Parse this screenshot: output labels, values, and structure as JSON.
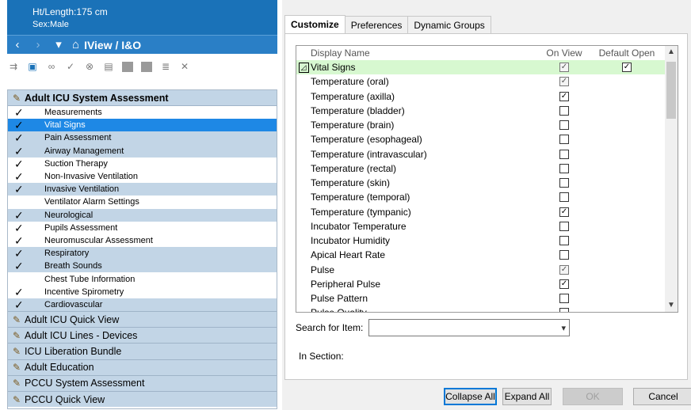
{
  "patient": {
    "height": "Ht/Length:175 cm",
    "sex": "Sex:Male"
  },
  "nav": {
    "back": "‹",
    "forward": "›",
    "dropdown": "▾",
    "home": "⌂",
    "title": "IView / I&O"
  },
  "toolbar_icons": [
    "link-icon",
    "view-icon",
    "glasses-icon",
    "check-icon",
    "cancel-circle-icon",
    "clipboard-icon",
    "grey-block-icon",
    "grey-block-icon",
    "notes-icon",
    "close-icon"
  ],
  "sidebar": {
    "top_section": "Adult ICU System Assessment",
    "rows": [
      {
        "label": "Measurements",
        "checked": true,
        "style": "plain"
      },
      {
        "label": "Vital Signs",
        "checked": true,
        "style": "sel"
      },
      {
        "label": "Pain Assessment",
        "checked": true,
        "style": "alt"
      },
      {
        "label": "Airway Management",
        "checked": true,
        "style": "alt"
      },
      {
        "label": "Suction Therapy",
        "checked": true,
        "style": "plain"
      },
      {
        "label": "Non-Invasive Ventilation",
        "checked": true,
        "style": "plain"
      },
      {
        "label": "Invasive Ventilation",
        "checked": true,
        "style": "alt"
      },
      {
        "label": "Ventilator Alarm Settings",
        "checked": false,
        "style": "plain"
      },
      {
        "label": "Neurological",
        "checked": true,
        "style": "alt"
      },
      {
        "label": "Pupils Assessment",
        "checked": true,
        "style": "plain"
      },
      {
        "label": "Neuromuscular Assessment",
        "checked": true,
        "style": "plain"
      },
      {
        "label": "Respiratory",
        "checked": true,
        "style": "alt"
      },
      {
        "label": "Breath Sounds",
        "checked": true,
        "style": "alt"
      },
      {
        "label": "Chest Tube Information",
        "checked": false,
        "style": "plain"
      },
      {
        "label": "Incentive Spirometry",
        "checked": true,
        "style": "plain"
      },
      {
        "label": "Cardiovascular",
        "checked": true,
        "style": "alt"
      }
    ],
    "groups": [
      "Adult ICU Quick View",
      "Adult ICU Lines - Devices",
      "ICU Liberation Bundle",
      "Adult Education",
      "PCCU System Assessment",
      "PCCU Quick View"
    ],
    "check_glyph": "✓"
  },
  "tabs": [
    "Customize",
    "Preferences",
    "Dynamic Groups"
  ],
  "grid": {
    "headers": {
      "name": "Display Name",
      "on_view": "On View",
      "default_open": "Default Open"
    },
    "rows": [
      {
        "name": "Vital Signs",
        "on": true,
        "on_dis": true,
        "def": true,
        "expander": true,
        "hl": true
      },
      {
        "name": "Temperature (oral)",
        "on": true,
        "on_dis": true
      },
      {
        "name": "Temperature (axilla)",
        "on": true
      },
      {
        "name": "Temperature (bladder)",
        "on": false
      },
      {
        "name": "Temperature (brain)",
        "on": false
      },
      {
        "name": "Temperature (esophageal)",
        "on": false
      },
      {
        "name": "Temperature (intravascular)",
        "on": false
      },
      {
        "name": "Temperature (rectal)",
        "on": false
      },
      {
        "name": "Temperature (skin)",
        "on": false
      },
      {
        "name": "Temperature (temporal)",
        "on": false
      },
      {
        "name": "Temperature (tympanic)",
        "on": true
      },
      {
        "name": "Incubator Temperature",
        "on": false
      },
      {
        "name": "Incubator Humidity",
        "on": false
      },
      {
        "name": "Apical Heart Rate",
        "on": false
      },
      {
        "name": "Pulse",
        "on": true,
        "on_dis": true
      },
      {
        "name": "Peripheral Pulse",
        "on": true
      },
      {
        "name": "Pulse Pattern",
        "on": false
      },
      {
        "name": "Pulse Quality",
        "on": false
      }
    ],
    "expander_glyph": "◿",
    "check_glyph": "✓",
    "scroll_up": "▲",
    "scroll_down": "▼"
  },
  "search": {
    "label": "Search for Item:",
    "value": "",
    "dropdown": "▾"
  },
  "in_section": {
    "label": "In Section:"
  },
  "buttons": {
    "collapse_all": "Collapse All",
    "expand_all": "Expand All",
    "ok": "OK",
    "cancel": "Cancel"
  }
}
